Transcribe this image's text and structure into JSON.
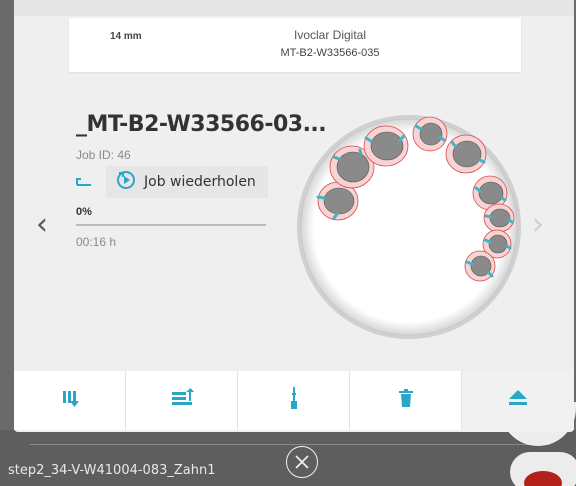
{
  "header": {
    "thickness": "14 mm",
    "brand": "Ivoclar Digital",
    "job_code": "MT-B2-W33566-035"
  },
  "job": {
    "title": "_MT-B2-W33566-03...",
    "job_id": "Job ID: 46",
    "repeat_label": "Job wiederholen",
    "progress_text": "0%",
    "progress_value": 0.0,
    "duration": "00:16 h"
  },
  "navigation": {
    "prev_icon": "chevron-left-icon",
    "next_icon": "chevron-right-icon"
  },
  "toolbar": {
    "items": [
      {
        "icon": "sort-down-icon"
      },
      {
        "icon": "transfer-icon"
      },
      {
        "icon": "tool-icon"
      },
      {
        "icon": "trash-icon"
      },
      {
        "icon": "eject-icon"
      }
    ],
    "accent_color": "#2aa6c9"
  },
  "background": {
    "next_job_name": "step2_34-V-W41004-083_Zahn1",
    "close_icon": "close-circle-icon",
    "status_color": "#b3211a"
  },
  "colors": {
    "accent": "#2aa6c9",
    "card": "#efefef"
  }
}
